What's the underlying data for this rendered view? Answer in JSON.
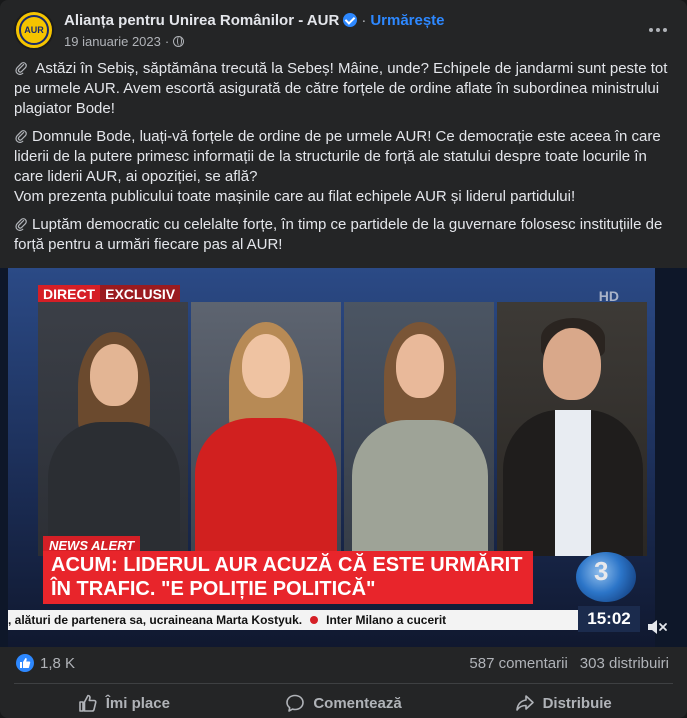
{
  "post": {
    "page_name": "Alianța pentru Unirea Românilor - AUR",
    "follow_label": "Urmărește",
    "separator": "·",
    "date": "19 ianuarie 2023",
    "avatar_text": "AUR",
    "paragraphs": [
      "Astăzi în Sebiș, săptămâna trecută la Sebeș! Mâine, unde? Echipele de jandarmi sunt peste tot pe urmele AUR. Avem escortă asigurată de către forțele de ordine aflate în subordinea ministrului plagiator Bode!",
      "Domnule Bode, luați-vă forțele de ordine de pe urmele AUR! Ce democrație este aceea în care liderii de la putere primesc informații de la structurile de forță ale statului despre toate locurile în care liderii AUR, ai opoziției, se află?",
      "Vom prezenta publicului toate mașinile care au filat echipele AUR și liderul partidului!",
      "Luptăm democratic cu celelalte forțe, în timp ce partidele de la guvernare folosesc instituțiile de forță pentru a urmări fiecare pas al AUR!"
    ]
  },
  "video": {
    "tag_direct": "DIRECT",
    "tag_exclusive": "EXCLUSIV",
    "hd": "HD",
    "news_alert": "NEWS ALERT",
    "headline_line1": "ACUM: LIDERUL AUR ACUZĂ CĂ ESTE URMĂRIT",
    "headline_line2": "ÎN TRAFIC. \"E POLIȚIE POLITICĂ\"",
    "ticker_left": ", alături de partenera sa, ucraineana Marta Kostyuk.",
    "ticker_right": "Inter Milano a cucerit",
    "clock": "15:02",
    "channel_logo": "3"
  },
  "stats": {
    "likes": "1,8 K",
    "comments": "587 comentarii",
    "shares": "303 distribuiri"
  },
  "actions": {
    "like": "Îmi place",
    "comment": "Comentează",
    "share": "Distribuie"
  },
  "colors": {
    "accent": "#2d88ff",
    "card_bg": "#242526",
    "alert_red": "#d51f26"
  }
}
